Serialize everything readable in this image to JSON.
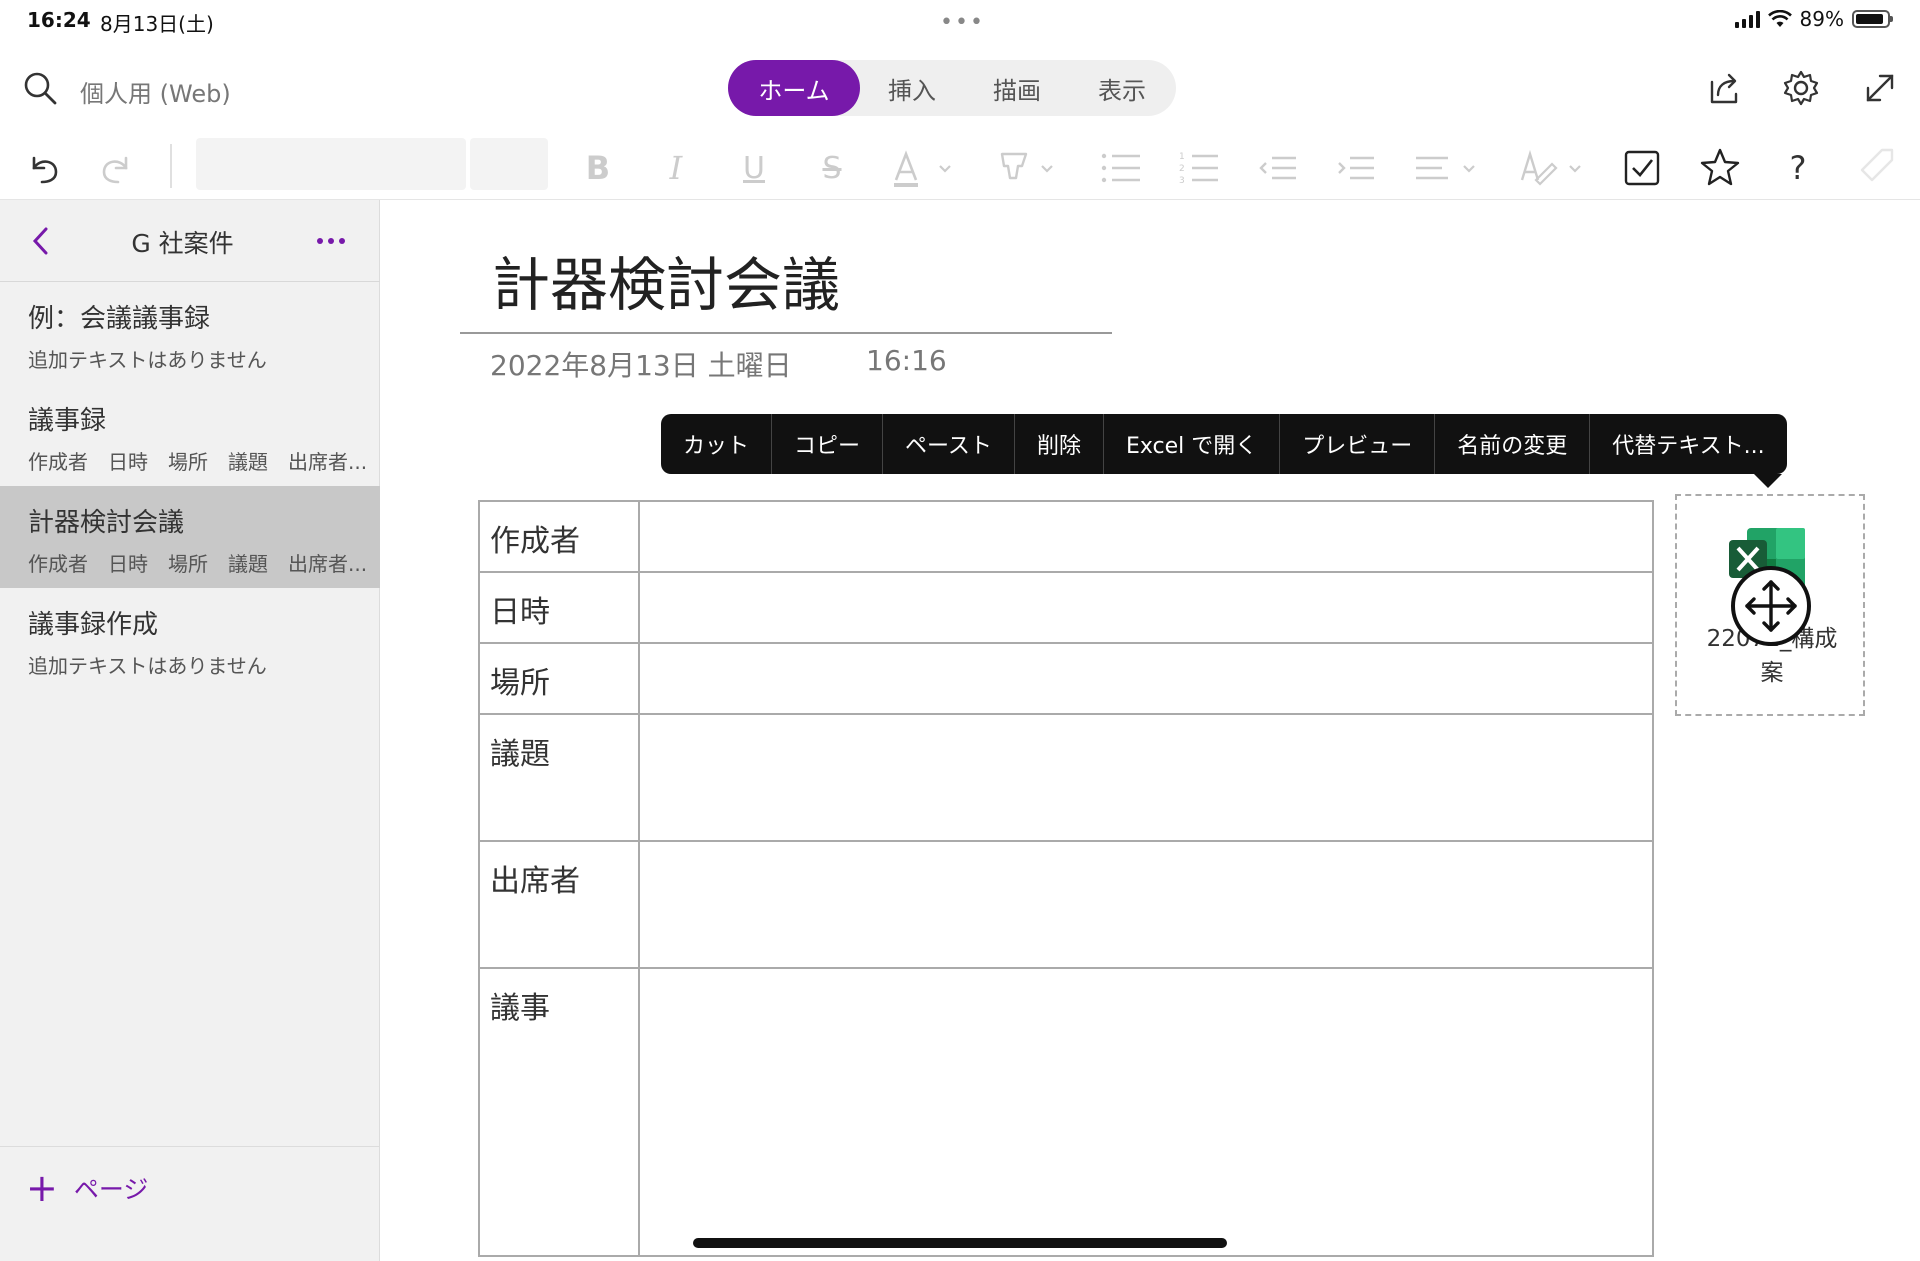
{
  "status_bar": {
    "time": "16:24",
    "date": "8月13日(土)",
    "battery": "89%",
    "battery_level": 0.89
  },
  "topbar": {
    "notebook_name": "個人用 (Web)",
    "tabs": [
      {
        "label": "ホーム",
        "active": true
      },
      {
        "label": "挿入",
        "active": false
      },
      {
        "label": "描画",
        "active": false
      },
      {
        "label": "表示",
        "active": false
      }
    ],
    "icons": [
      "search-icon",
      "share-icon",
      "gear-icon",
      "expand-icon"
    ]
  },
  "toolbar": {
    "icons": [
      "undo-icon",
      "redo-icon",
      "bold-icon",
      "italic-icon",
      "underline-icon",
      "strikethrough-icon",
      "font-color-icon",
      "highlighter-icon",
      "bullet-list-icon",
      "numbered-list-icon",
      "outdent-icon",
      "indent-icon",
      "align-icon",
      "style-icon",
      "checkbox-icon",
      "star-icon",
      "help-icon",
      "tag-icon"
    ]
  },
  "sidebar": {
    "section_title": "G 社案件",
    "pages": [
      {
        "title": "例：会議議事録",
        "preview": "追加テキストはありません",
        "selected": false
      },
      {
        "title": "議事録",
        "preview": "作成者　日時　場所　議題　出席者...",
        "selected": false
      },
      {
        "title": "計器検討会議",
        "preview": "作成者　日時　場所　議題　出席者...",
        "selected": true
      },
      {
        "title": "議事録作成",
        "preview": "追加テキストはありません",
        "selected": false
      }
    ],
    "add_page_label": "ページ"
  },
  "note": {
    "title": "計器検討会議",
    "date": "2022年8月13日 土曜日",
    "time": "16:16",
    "table_rows": [
      {
        "label": "作成者",
        "value": ""
      },
      {
        "label": "日時",
        "value": ""
      },
      {
        "label": "場所",
        "value": ""
      },
      {
        "label": "議題",
        "value": ""
      },
      {
        "label": "出席者",
        "value": ""
      },
      {
        "label": "議事",
        "value": ""
      }
    ],
    "attachment": {
      "name_line1": "22071_構成",
      "name_line2": "案",
      "icon": "excel-icon"
    }
  },
  "context_menu": {
    "items": [
      "カット",
      "コピー",
      "ペースト",
      "削除",
      "Excel で開く",
      "プレビュー",
      "名前の変更",
      "代替テキスト..."
    ]
  },
  "colors": {
    "accent": "#7719aa",
    "menu_bg": "#111111",
    "sidebar_bg": "#f1f1f1",
    "selected_bg": "#c8c8c8"
  }
}
